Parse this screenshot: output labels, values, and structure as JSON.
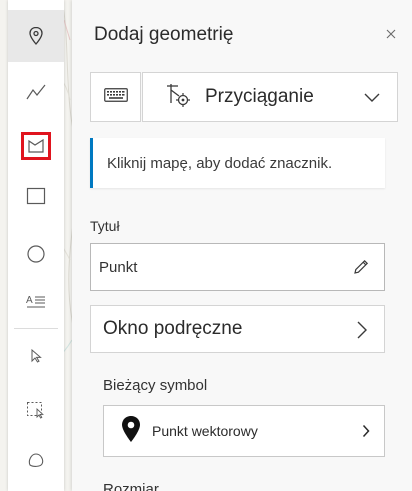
{
  "panel": {
    "title": "Dodaj geometrię",
    "snapping_label": "Przyciąganie",
    "notice": "Kliknij mapę, aby dodać znacznik.",
    "title_field_label": "Tytuł",
    "title_field_value": "Punkt",
    "popup_label": "Okno podręczne",
    "current_symbol_label": "Bieżący symbol",
    "symbol_name": "Punkt wektorowy",
    "size_label": "Rozmiar"
  },
  "toolbar": {
    "tools": [
      {
        "name": "point",
        "icon": "map-pin-icon",
        "active": true
      },
      {
        "name": "polyline",
        "icon": "polyline-icon",
        "active": false
      },
      {
        "name": "polygon",
        "icon": "polygon-icon",
        "active": false,
        "highlighted": true
      },
      {
        "name": "rectangle",
        "icon": "rectangle-icon",
        "active": false
      },
      {
        "name": "circle",
        "icon": "circle-icon",
        "active": false
      },
      {
        "name": "text",
        "icon": "text-icon",
        "active": false
      },
      {
        "name": "select",
        "icon": "cursor-icon",
        "active": false
      },
      {
        "name": "select-by-rectangle",
        "icon": "select-rectangle-icon",
        "active": false
      },
      {
        "name": "lasso",
        "icon": "lasso-icon",
        "active": false
      }
    ]
  },
  "colors": {
    "highlight": "#e0141e",
    "notice_accent": "#0079c1"
  }
}
